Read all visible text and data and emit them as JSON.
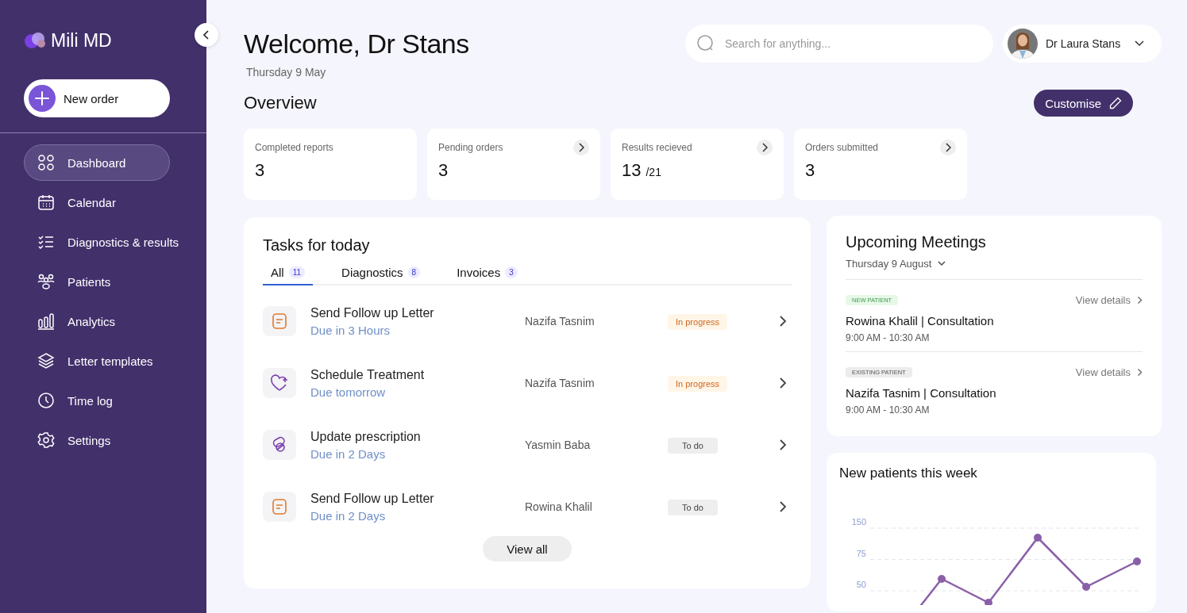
{
  "sidebar": {
    "logo": "Mili MD",
    "new_order": "New order",
    "items": [
      {
        "label": "Dashboard",
        "selected": true
      },
      {
        "label": "Calendar",
        "selected": false
      },
      {
        "label": "Diagnostics & results",
        "selected": false
      },
      {
        "label": "Patients",
        "selected": false
      },
      {
        "label": "Analytics",
        "selected": false
      },
      {
        "label": "Letter templates",
        "selected": false
      },
      {
        "label": "Time log",
        "selected": false
      },
      {
        "label": "Settings",
        "selected": false
      }
    ]
  },
  "header": {
    "title": "Welcome, Dr Stans",
    "date": "Thursday 9 May",
    "search": {
      "placeholder": "Search for anything..."
    },
    "user": {
      "name": "Dr Laura Stans"
    }
  },
  "overview": {
    "title": "Overview",
    "customise": "Customise",
    "cards": [
      {
        "label": "Completed reports",
        "value": "3",
        "arrow": false
      },
      {
        "label": "Pending orders",
        "value": "3",
        "arrow": true
      },
      {
        "label": "Results recieved",
        "value": "13",
        "total": "/21",
        "arrow": true
      },
      {
        "label": "Orders submitted",
        "value": "3",
        "arrow": true
      }
    ]
  },
  "tasks": {
    "title": "Tasks for today",
    "tabs": [
      {
        "label": "All",
        "count": "11",
        "selected": true
      },
      {
        "label": "Diagnostics",
        "count": "8",
        "selected": false
      },
      {
        "label": "Invoices",
        "count": "3",
        "selected": false
      }
    ],
    "rows": [
      {
        "title": "Send Follow up Letter",
        "due": "Due in 3 Hours",
        "patient": "Nazifa Tasnim",
        "status": "In progress",
        "kind": "in_progress"
      },
      {
        "title": "Schedule Treatment",
        "due": "Due tomorrow",
        "patient": "Nazifa Tasnim",
        "status": "In progress",
        "kind": "in_progress"
      },
      {
        "title": "Update prescription",
        "due": "Due in 2 Days",
        "patient": "Yasmin Baba",
        "status": "To do",
        "kind": "to_do"
      },
      {
        "title": "Send Follow up Letter",
        "due": "Due in 2 Days",
        "patient": "Rowina Khalil",
        "status": "To do",
        "kind": "to_do"
      }
    ],
    "view_all": "View all"
  },
  "meetings": {
    "title": "Upcoming Meetings",
    "date": "Thursday 9 August",
    "items": [
      {
        "tag": "NEW PATIENT",
        "kind": "new",
        "link": "View details",
        "title": "Rowina Khalil | Consultation",
        "time": "9:00 AM - 10:30 AM"
      },
      {
        "tag": "EXISTING PATIENT",
        "kind": "existing",
        "link": "View details",
        "title": "Nazifa Tasnim | Consultation",
        "time": "9:00 AM - 10:30 AM"
      }
    ]
  },
  "new_patients": {
    "title": "New patients this week",
    "axis_labels": [
      "150",
      "75",
      "50"
    ]
  }
}
